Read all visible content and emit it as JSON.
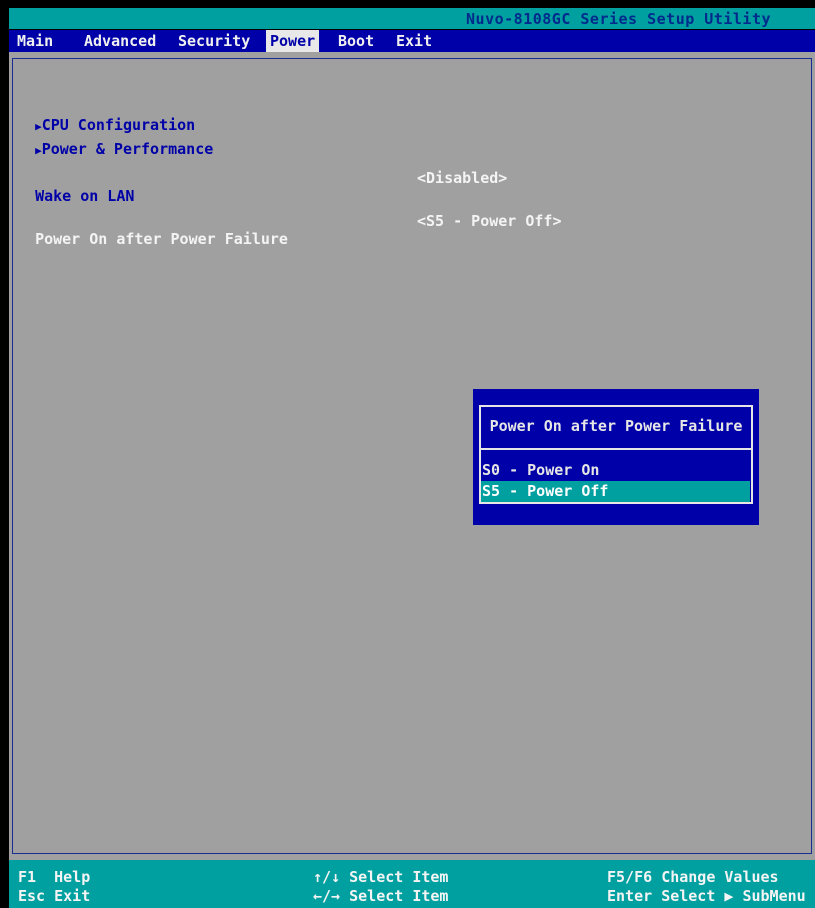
{
  "window": {
    "title": "Nuvo-8108GC Series Setup Utility"
  },
  "menu": {
    "tabs": [
      {
        "label": "Main"
      },
      {
        "label": "Advanced"
      },
      {
        "label": "Security"
      },
      {
        "label": "Power"
      },
      {
        "label": "Boot"
      },
      {
        "label": "Exit"
      }
    ],
    "active": "Power"
  },
  "main": {
    "submenus": [
      {
        "marker": "▶",
        "label": "CPU Configuration"
      },
      {
        "marker": "▶",
        "label": "Power & Performance"
      }
    ],
    "settings": [
      {
        "label": "Wake on LAN",
        "value": "<Disabled>"
      },
      {
        "label": "Power On after Power Failure",
        "value": "<S5 - Power Off>"
      }
    ]
  },
  "popup": {
    "title": "Power On after Power Failure",
    "options": [
      {
        "label": "S0 - Power On"
      },
      {
        "label": "S5 - Power Off"
      }
    ],
    "selected_index": 1
  },
  "footer": {
    "hotkeys": [
      {
        "key": "F1",
        "action": "Help"
      },
      {
        "key": "Esc",
        "action": "Exit"
      },
      {
        "key": "↑/↓",
        "action": "Select Item"
      },
      {
        "key": "←/→",
        "action": "Select Item"
      },
      {
        "key": "F5/F6",
        "action": "Change Values"
      },
      {
        "key": "Enter",
        "action": "Select ▶ SubMenu"
      }
    ]
  },
  "colors": {
    "title_bar": "#00a0a0",
    "menu_bar": "#0000a8",
    "content_bg": "#a0a0a0",
    "highlight": "#00a0a0"
  }
}
